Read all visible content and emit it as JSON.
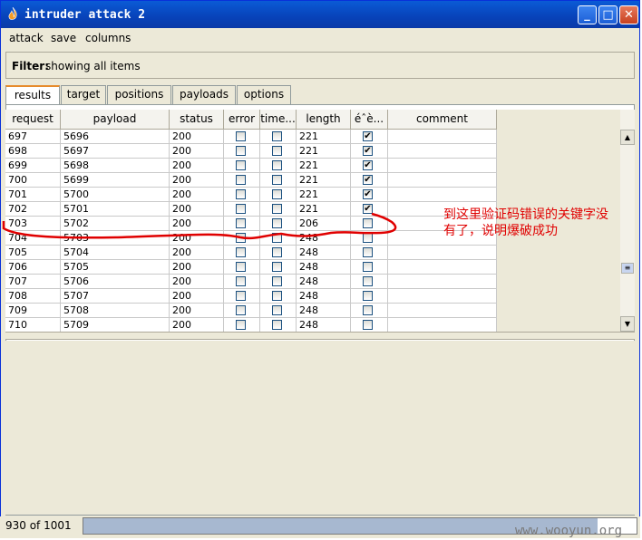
{
  "window": {
    "title": "intruder attack 2"
  },
  "menu": [
    "attack",
    "save",
    "columns"
  ],
  "filter": {
    "label": "Filter:",
    "value": "showing all items"
  },
  "tabs": [
    "results",
    "target",
    "positions",
    "payloads",
    "options"
  ],
  "columns": [
    "request",
    "payload",
    "status",
    "error",
    "time...",
    "length",
    "éˆè...",
    "comment"
  ],
  "rows": [
    {
      "request": "697",
      "payload": "5696",
      "status": "200",
      "error": false,
      "timeout": false,
      "length": "221",
      "match": true
    },
    {
      "request": "698",
      "payload": "5697",
      "status": "200",
      "error": false,
      "timeout": false,
      "length": "221",
      "match": true
    },
    {
      "request": "699",
      "payload": "5698",
      "status": "200",
      "error": false,
      "timeout": false,
      "length": "221",
      "match": true
    },
    {
      "request": "700",
      "payload": "5699",
      "status": "200",
      "error": false,
      "timeout": false,
      "length": "221",
      "match": true
    },
    {
      "request": "701",
      "payload": "5700",
      "status": "200",
      "error": false,
      "timeout": false,
      "length": "221",
      "match": true
    },
    {
      "request": "702",
      "payload": "5701",
      "status": "200",
      "error": false,
      "timeout": false,
      "length": "221",
      "match": true
    },
    {
      "request": "703",
      "payload": "5702",
      "status": "200",
      "error": false,
      "timeout": false,
      "length": "206",
      "match": false
    },
    {
      "request": "704",
      "payload": "5703",
      "status": "200",
      "error": false,
      "timeout": false,
      "length": "248",
      "match": false
    },
    {
      "request": "705",
      "payload": "5704",
      "status": "200",
      "error": false,
      "timeout": false,
      "length": "248",
      "match": false
    },
    {
      "request": "706",
      "payload": "5705",
      "status": "200",
      "error": false,
      "timeout": false,
      "length": "248",
      "match": false
    },
    {
      "request": "707",
      "payload": "5706",
      "status": "200",
      "error": false,
      "timeout": false,
      "length": "248",
      "match": false
    },
    {
      "request": "708",
      "payload": "5707",
      "status": "200",
      "error": false,
      "timeout": false,
      "length": "248",
      "match": false
    },
    {
      "request": "709",
      "payload": "5708",
      "status": "200",
      "error": false,
      "timeout": false,
      "length": "248",
      "match": false
    },
    {
      "request": "710",
      "payload": "5709",
      "status": "200",
      "error": false,
      "timeout": false,
      "length": "248",
      "match": false
    }
  ],
  "annotation": {
    "line1": "到这里验证码错误的关键字没",
    "line2": "有了，说明爆破成功"
  },
  "status": {
    "count": "930 of 1001",
    "progress": 0.93
  },
  "watermark": "www.wooyun.org",
  "colors": {
    "title_bar": "#0842b9",
    "annotation": "#e00000",
    "selected_tab_accent": "#e68b2c"
  }
}
